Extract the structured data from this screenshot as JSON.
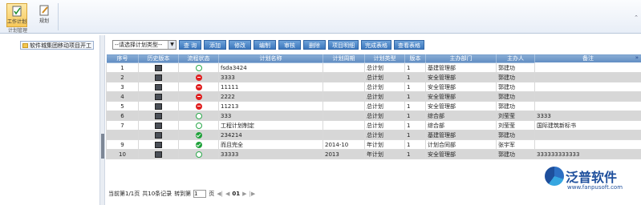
{
  "ribbon": {
    "buttons": [
      {
        "label": "工作计划",
        "active": true,
        "icon": "check-doc-icon"
      },
      {
        "label": "规划",
        "active": false,
        "icon": "edit-doc-icon"
      }
    ],
    "group_label": "计划管理"
  },
  "sidebar": {
    "tree_item": "软件城集团移动项目开工"
  },
  "toolbar": {
    "select_value": "--请选择计划类型--",
    "buttons": [
      "查 询",
      "添加",
      "修改",
      "编制",
      "审核",
      "删除",
      "项目明细",
      "完成表格",
      "查看表格"
    ]
  },
  "table": {
    "columns": [
      "序号",
      "历史版本",
      "流程状态",
      "计划名称",
      "计划周期",
      "计划类型",
      "版本",
      "主办部门",
      "主办人",
      "备注"
    ],
    "rows": [
      {
        "no": "1",
        "status": "cycle",
        "name": "fsda3424",
        "period": "",
        "type": "总计划",
        "ver": "1",
        "dept": "基建管理部",
        "owner": "郭建功",
        "note": ""
      },
      {
        "no": "2",
        "status": "red",
        "name": "3333",
        "period": "",
        "type": "总计划",
        "ver": "1",
        "dept": "安全管理部",
        "owner": "郭建功",
        "note": ""
      },
      {
        "no": "3",
        "status": "red",
        "name": "11111",
        "period": "",
        "type": "总计划",
        "ver": "1",
        "dept": "安全管理部",
        "owner": "郭建功",
        "note": ""
      },
      {
        "no": "4",
        "status": "red",
        "name": "2222",
        "period": "",
        "type": "总计划",
        "ver": "1",
        "dept": "安全管理部",
        "owner": "郭建功",
        "note": ""
      },
      {
        "no": "5",
        "status": "red",
        "name": "11213",
        "period": "",
        "type": "总计划",
        "ver": "1",
        "dept": "安全管理部",
        "owner": "郭建功",
        "note": ""
      },
      {
        "no": "6",
        "status": "cycle",
        "name": "333",
        "period": "",
        "type": "总计划",
        "ver": "1",
        "dept": "综合部",
        "owner": "刘莹莹",
        "note": "3333"
      },
      {
        "no": "7",
        "status": "cycle",
        "name": "工程计划制定",
        "period": "",
        "type": "总计划",
        "ver": "1",
        "dept": "综合部",
        "owner": "刘莹莹",
        "note": "国际建筑新标书"
      },
      {
        "no": "",
        "status": "green",
        "name": "234214",
        "period": "",
        "type": "总计划",
        "ver": "1",
        "dept": "基建管理部",
        "owner": "郭建功",
        "note": ""
      },
      {
        "no": "9",
        "status": "green",
        "name": "而且完全",
        "period": "2014-10",
        "type": "年计划",
        "ver": "1",
        "dept": "计划合同部",
        "owner": "张宇军",
        "note": ""
      },
      {
        "no": "10",
        "status": "cycle",
        "name": "33333",
        "period": "2013",
        "type": "年计划",
        "ver": "1",
        "dept": "安全管理部",
        "owner": "郭建功",
        "note": "333333333333"
      }
    ]
  },
  "pager": {
    "page_info": "当前第1/1页",
    "total": "共10条记录",
    "goto_label": "转到第",
    "goto_value": "1",
    "page_suffix": "页",
    "current_page": "01"
  },
  "logo": {
    "name": "泛普软件",
    "url": "www.fanpusoft.com"
  }
}
